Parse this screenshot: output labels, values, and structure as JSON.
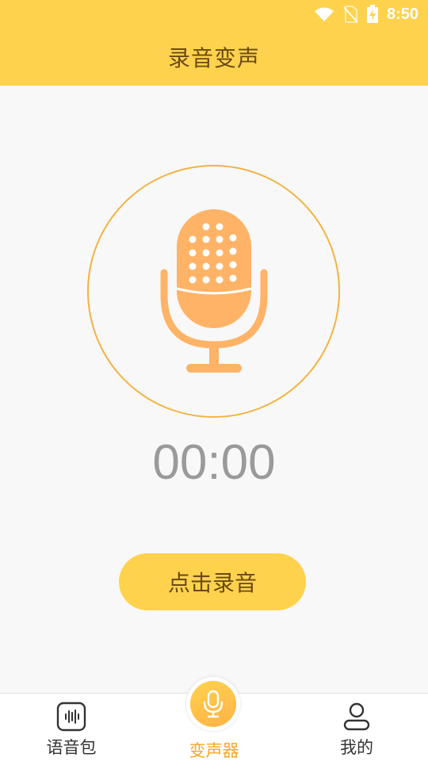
{
  "status_bar": {
    "time": "8:50",
    "icons": [
      "wifi-icon",
      "no-sim-icon",
      "battery-charging-icon"
    ]
  },
  "header": {
    "title": "录音变声"
  },
  "recorder": {
    "icon": "microphone-icon",
    "timer": "00:00",
    "record_label": "点击录音"
  },
  "bottom_nav": {
    "items": [
      {
        "label": "语音包",
        "icon": "voice-pack-icon",
        "active": false
      },
      {
        "label": "变声器",
        "icon": "microphone-icon",
        "active": true
      },
      {
        "label": "我的",
        "icon": "user-icon",
        "active": false
      }
    ]
  },
  "colors": {
    "primary_yellow": "#ffd24d",
    "accent_orange": "#f5a623",
    "mic_orange": "#ffb366",
    "ring_orange": "#f2b340",
    "title_brown": "#6b4a12",
    "timer_gray": "#9a9a9a"
  }
}
